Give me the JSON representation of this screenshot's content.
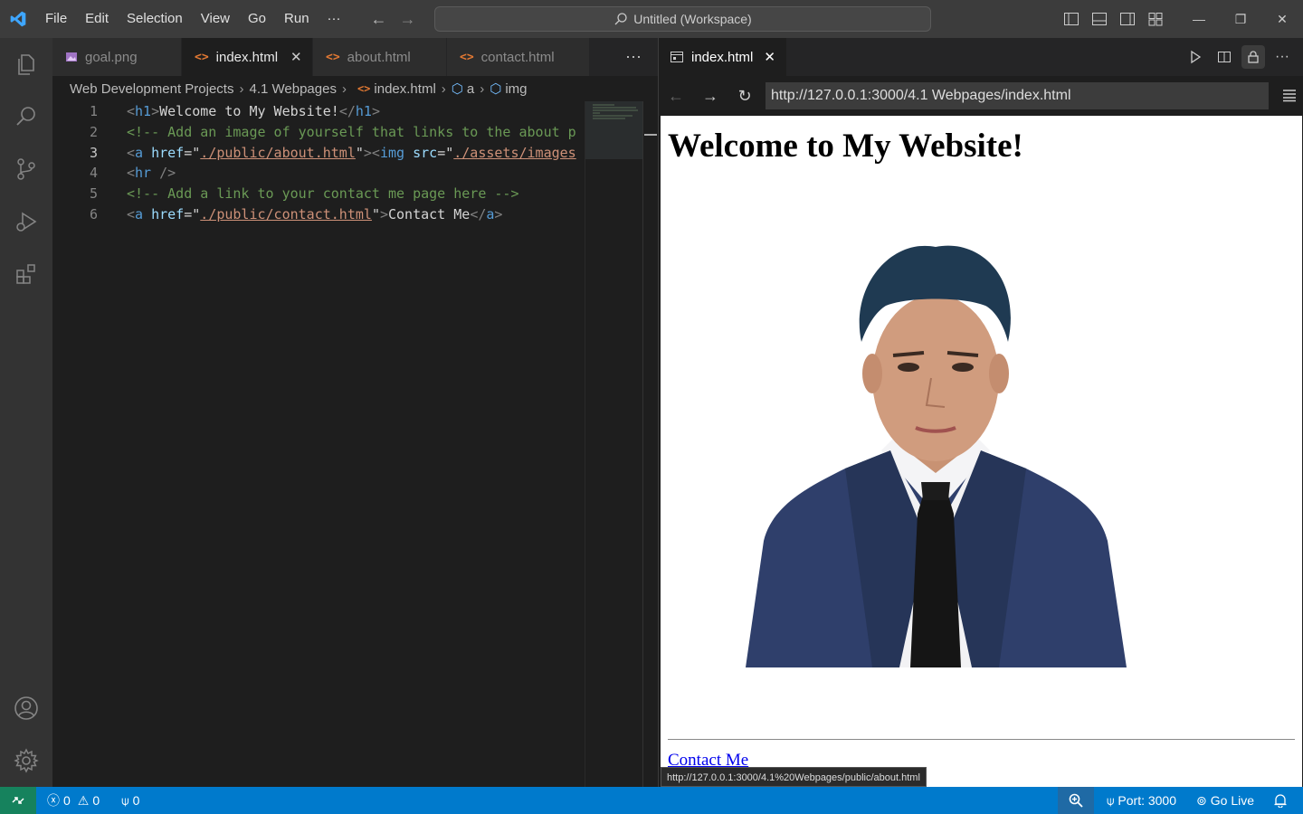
{
  "titlebar": {
    "menu": [
      "File",
      "Edit",
      "Selection",
      "View",
      "Go",
      "Run"
    ],
    "more": "···",
    "command_center": "Untitled (Workspace)"
  },
  "editor": {
    "tabs": [
      {
        "label": "goal.png",
        "active": false
      },
      {
        "label": "index.html",
        "active": true,
        "close": "✕"
      },
      {
        "label": "about.html",
        "active": false
      },
      {
        "label": "contact.html",
        "active": false
      }
    ],
    "tab_more": "···",
    "breadcrumb": [
      "Web Development Projects",
      "4.1 Webpages",
      "index.html",
      "a",
      "img"
    ],
    "line_numbers": [
      "1",
      "2",
      "3",
      "4",
      "5",
      "6"
    ],
    "code": {
      "l1": {
        "open": "<",
        "tag": "h1",
        "close": ">",
        "text": "Welcome to My Website!",
        "end_open": "</",
        "end_tag": "h1",
        "end_close": ">"
      },
      "l2": "<!-- Add an image of yourself that links to the about p",
      "l3": {
        "lt": "<",
        "a": "a",
        "href": "href",
        "eq": "=\"",
        "href_val": "./public/about.html",
        "q": "\"",
        "gt": "><",
        "img": "img",
        "src": "src",
        "eq2": "=\"",
        "src_val": "./assets/images"
      },
      "l4": {
        "lt": "<",
        "hr": "hr",
        "end": " />"
      },
      "l5": "<!-- Add a link to your contact me page here -->",
      "l6": {
        "lt": "<",
        "a": "a",
        "href": "href",
        "eq": "=\"",
        "href_val": "./public/contact.html",
        "q": "\"",
        "gt": ">",
        "text": "Contact Me",
        "end_open": "</",
        "end_tag": "a",
        "end_close": ">"
      }
    }
  },
  "browser": {
    "tab_label": "index.html",
    "tab_close": "✕",
    "url": "http://127.0.0.1:3000/4.1 Webpages/index.html",
    "page": {
      "heading": "Welcome to My Website!",
      "link_text": "Contact Me"
    },
    "link_status": "http://127.0.0.1:3000/4.1%20Webpages/public/about.html"
  },
  "statusbar": {
    "errors": "0",
    "warnings": "0",
    "ports": "0",
    "port": "Port: 3000",
    "go_live": "Go Live"
  },
  "colors": {
    "accent": "#007acc",
    "remote": "#16825d",
    "titlebar": "#3c3c3c",
    "activitybar": "#333333"
  }
}
